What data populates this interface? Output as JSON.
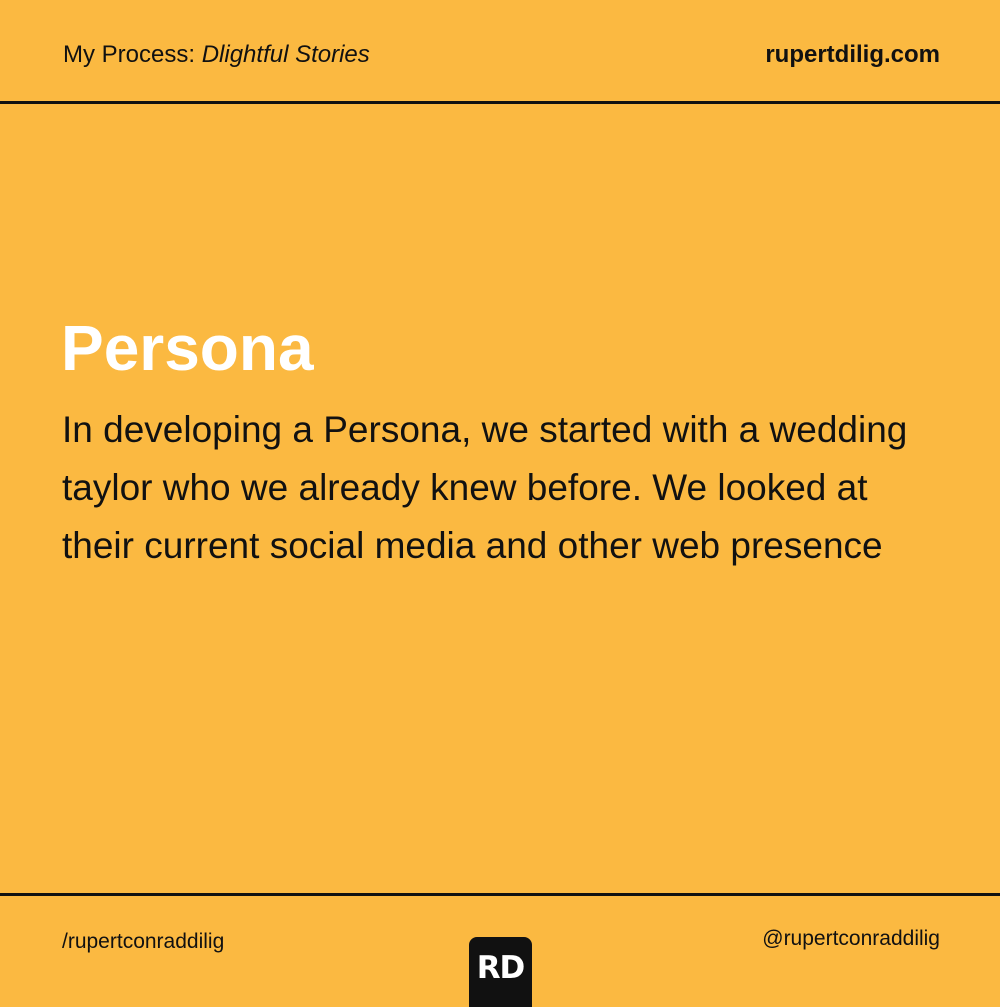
{
  "header": {
    "prefix": "My Process: ",
    "series": "Dlightful Stories",
    "website": "rupertdilig.com"
  },
  "main": {
    "title": "Persona",
    "body": "In developing a Persona, we started with a wedding taylor who we already knew before. We looked at their current social media and other web presence"
  },
  "footer": {
    "left_handle": "/rupertconraddilig",
    "right_handle": "@rupertconraddilig",
    "logo_text": "RD"
  },
  "colors": {
    "background": "#FBB941",
    "text": "#111111",
    "title": "#FFFFFF"
  }
}
